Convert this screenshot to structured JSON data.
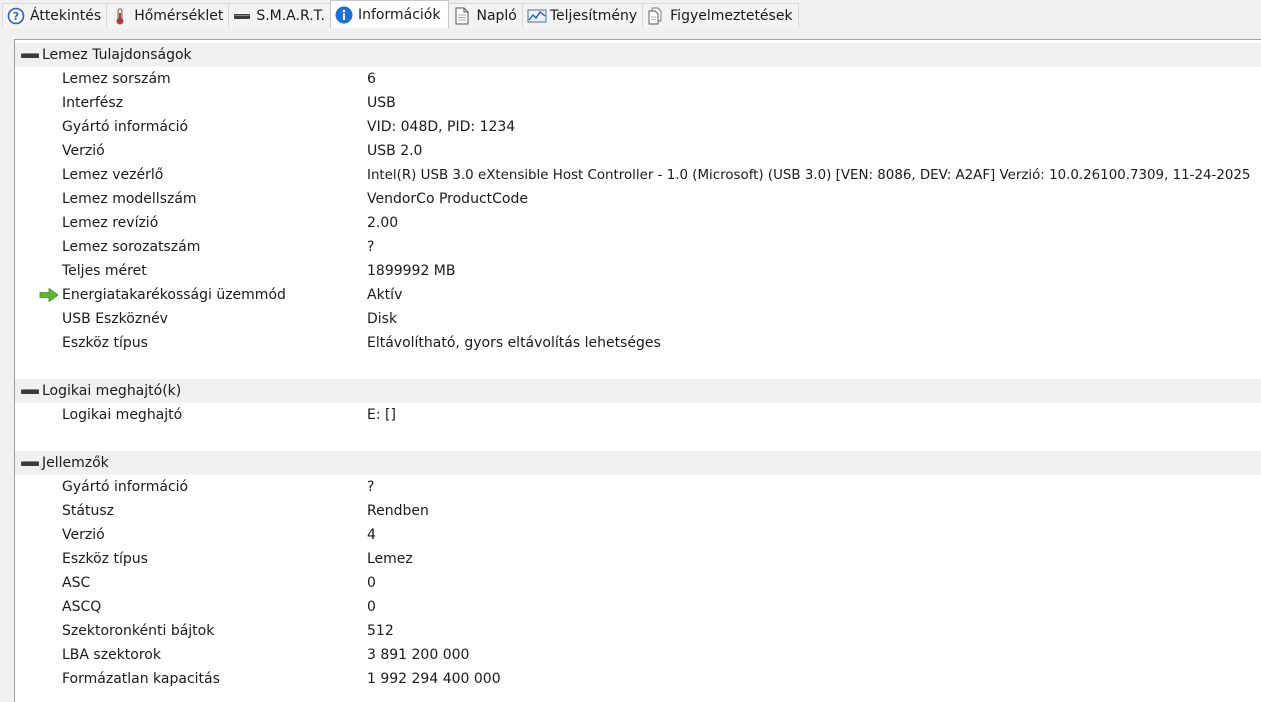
{
  "tabs": [
    {
      "label": "Áttekintés",
      "icon": "help-circle-icon",
      "active": false
    },
    {
      "label": "Hőmérséklet",
      "icon": "thermometer-icon",
      "active": false
    },
    {
      "label": "S.M.A.R.T.",
      "icon": "drive-icon",
      "active": false
    },
    {
      "label": "Információk",
      "icon": "info-icon",
      "active": true
    },
    {
      "label": "Napló",
      "icon": "document-icon",
      "active": false
    },
    {
      "label": "Teljesítmény",
      "icon": "chart-icon",
      "active": false
    },
    {
      "label": "Figyelmeztetések",
      "icon": "alerts-icon",
      "active": false
    }
  ],
  "sections": [
    {
      "title": "Lemez Tulajdonságok",
      "rows": [
        {
          "key": "Lemez sorszám",
          "value": "6"
        },
        {
          "key": "Interfész",
          "value": "USB"
        },
        {
          "key": "Gyártó információ",
          "value": "VID: 048D, PID: 1234"
        },
        {
          "key": "Verzió",
          "value": "USB 2.0"
        },
        {
          "key": "Lemez vezérlő",
          "value": "Intel(R) USB 3.0 eXtensible Host Controller - 1.0 (Microsoft) (USB 3.0) [VEN: 8086, DEV: A2AF] Verzió: 10.0.26100.7309, 11-24-2025"
        },
        {
          "key": "Lemez modellszám",
          "value": "VendorCo ProductCode"
        },
        {
          "key": "Lemez revízió",
          "value": "2.00"
        },
        {
          "key": "Lemez sorozatszám",
          "value": "?"
        },
        {
          "key": "Teljes méret",
          "value": "1899992 MB"
        },
        {
          "key": "Energiatakarékossági üzemmód",
          "value": "Aktív",
          "icon": "green-arrow-icon"
        },
        {
          "key": "USB Eszköznév",
          "value": "Disk"
        },
        {
          "key": "Eszköz típus",
          "value": "Eltávolítható, gyors eltávolítás lehetséges"
        }
      ]
    },
    {
      "title": "Logikai meghajtó(k)",
      "rows": [
        {
          "key": "Logikai meghajtó",
          "value": "E: []"
        }
      ]
    },
    {
      "title": "Jellemzők",
      "rows": [
        {
          "key": "Gyártó információ",
          "value": "?"
        },
        {
          "key": "Státusz",
          "value": "Rendben"
        },
        {
          "key": "Verzió",
          "value": "4"
        },
        {
          "key": "Eszköz típus",
          "value": "Lemez"
        },
        {
          "key": "ASC",
          "value": "0"
        },
        {
          "key": "ASCQ",
          "value": "0"
        },
        {
          "key": "Szektoronkénti bájtok",
          "value": "512"
        },
        {
          "key": "LBA szektorok",
          "value": "3 891 200 000"
        },
        {
          "key": "Formázatlan kapacitás",
          "value": "1 992 294 400 000"
        }
      ]
    }
  ],
  "colors": {
    "accent": "#1e6fd9",
    "arrow": "#5cb82e"
  }
}
